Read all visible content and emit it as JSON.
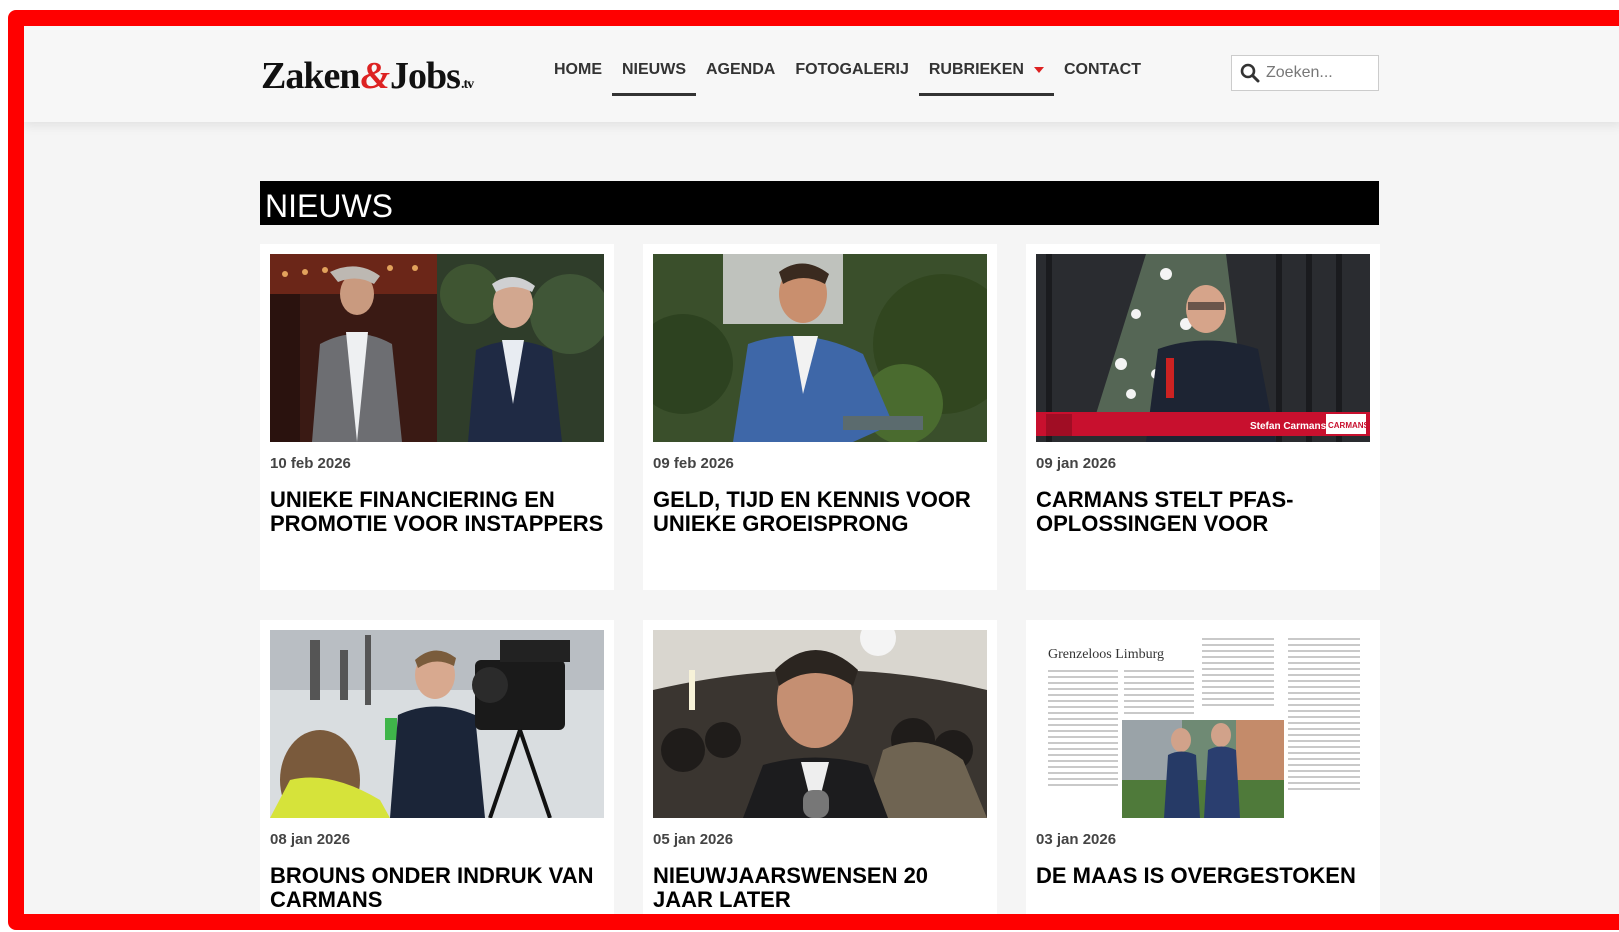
{
  "logo": {
    "part1": "Zaken",
    "amp": "&",
    "part2": "Jobs",
    "suffix": ".tv"
  },
  "nav": {
    "home": "HOME",
    "nieuws": "NIEUWS",
    "agenda": "AGENDA",
    "fotogalerij": "FOTOGALERIJ",
    "rubrieken": "RUBRIEKEN",
    "contact": "CONTACT"
  },
  "search": {
    "placeholder": "Zoeken..."
  },
  "section": {
    "title": "NIEUWS"
  },
  "articles": [
    {
      "date": "10 feb 2026",
      "title": "UNIEKE FINANCIERING EN PROMOTIE VOOR INSTAPPERS"
    },
    {
      "date": "09 feb 2026",
      "title": "GELD, TIJD EN KENNIS VOOR UNIEKE GROEISPRONG"
    },
    {
      "date": "09 jan 2026",
      "title": "CARMANS STELT PFAS-OPLOSSINGEN VOOR",
      "caption": "Stefan Carmans",
      "brand": "CARMANS"
    },
    {
      "date": "08 jan 2026",
      "title": "BROUNS ONDER INDRUK VAN CARMANS"
    },
    {
      "date": "05 jan 2026",
      "title": "NIEUWJAARSWENSEN 20 JAAR LATER"
    },
    {
      "date": "03 jan 2026",
      "title": "DE MAAS IS OVERGESTOKEN",
      "clip_heading": "Grenzeloos Limburg"
    }
  ]
}
